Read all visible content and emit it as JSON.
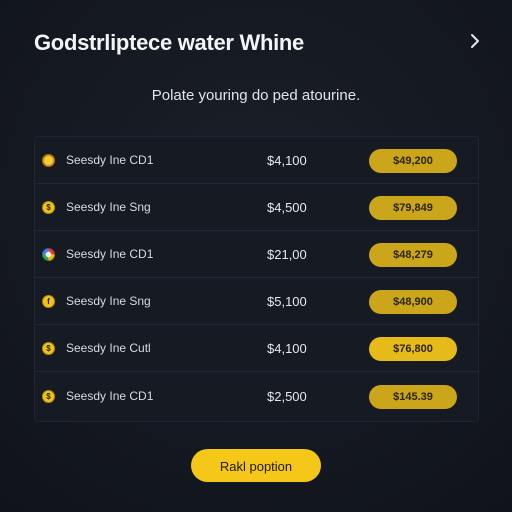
{
  "header": {
    "title": "Godstrliptece water Whine",
    "next_icon": "chevron-right-icon"
  },
  "subtitle": "Polate youring do ped atourine.",
  "rows": [
    {
      "icon": "coin-icon",
      "icon_style": "o",
      "glyph": "",
      "name": "Seesdy Ine CD1",
      "price": "$4,100",
      "action": "$49,200"
    },
    {
      "icon": "coin-icon",
      "icon_style": "y",
      "glyph": "$",
      "name": "Seesdy Ine Sng",
      "price": "$4,500",
      "action": "$79,849"
    },
    {
      "icon": "google-icon",
      "icon_style": "g",
      "glyph": "",
      "name": "Seesdy Ine CD1",
      "price": "$21,00",
      "action": "$48,279"
    },
    {
      "icon": "coin-icon",
      "icon_style": "y",
      "glyph": "f",
      "name": "Seesdy Ine Sng",
      "price": "$5,100",
      "action": "$48,900"
    },
    {
      "icon": "coin-icon",
      "icon_style": "y",
      "glyph": "$",
      "name": "Seesdy Ine Cutl",
      "price": "$4,100",
      "action": "$76,800"
    },
    {
      "icon": "coin-icon",
      "icon_style": "y",
      "glyph": "$",
      "name": "Seesdy Ine CD1",
      "price": "$2,500",
      "action": "$145.39"
    }
  ],
  "cta": {
    "label": "Rakl poption"
  },
  "colors": {
    "background": "#12161d",
    "accent": "#f4c718",
    "pill": "#cba51a"
  }
}
